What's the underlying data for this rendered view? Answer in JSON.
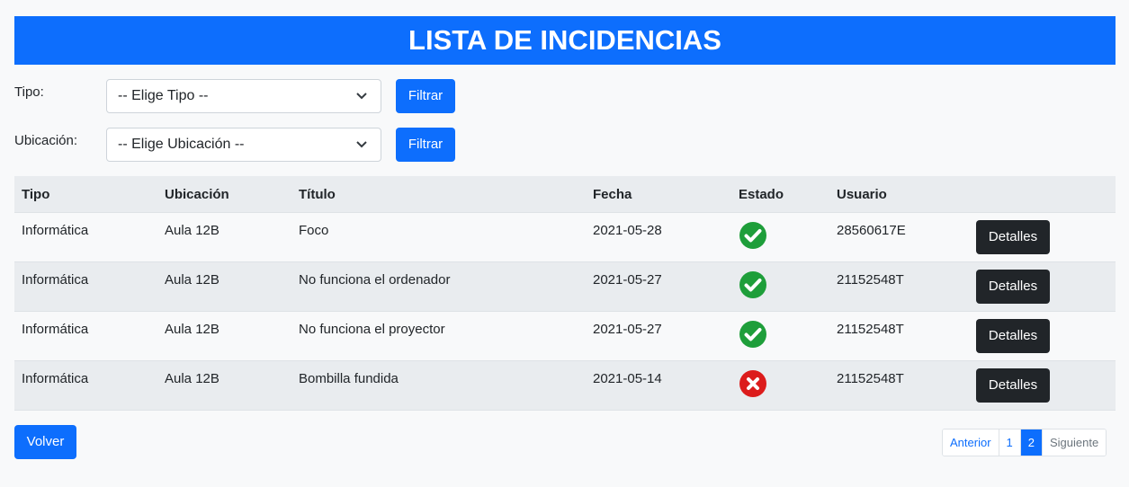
{
  "header": {
    "title": "LISTA DE INCIDENCIAS"
  },
  "filters": {
    "tipo_label": "Tipo:",
    "tipo_value": "-- Elige Tipo --",
    "ubicacion_label": "Ubicación:",
    "ubicacion_value": "-- Elige Ubicación --",
    "filter_button": "Filtrar"
  },
  "table": {
    "headers": [
      "Tipo",
      "Ubicación",
      "Título",
      "Fecha",
      "Estado",
      "Usuario"
    ],
    "rows": [
      {
        "tipo": "Informática",
        "ubicacion": "Aula 12B",
        "titulo": "Foco",
        "fecha": "2021-05-28",
        "estado": "check-icon",
        "usuario": "28560617E"
      },
      {
        "tipo": "Informática",
        "ubicacion": "Aula 12B",
        "titulo": "No funciona el ordenador",
        "fecha": "2021-05-27",
        "estado": "check-icon",
        "usuario": "21152548T"
      },
      {
        "tipo": "Informática",
        "ubicacion": "Aula 12B",
        "titulo": "No funciona el proyector",
        "fecha": "2021-05-27",
        "estado": "check-icon",
        "usuario": "21152548T"
      },
      {
        "tipo": "Informática",
        "ubicacion": "Aula 12B",
        "titulo": "Bombilla fundida",
        "fecha": "2021-05-14",
        "estado": "cross-icon",
        "usuario": "21152548T"
      }
    ],
    "details_button": "Detalles"
  },
  "footer": {
    "back_button": "Volver",
    "pagination": {
      "prev": "Anterior",
      "pages": [
        "1",
        "2"
      ],
      "active_page": "2",
      "next": "Siguiente"
    }
  },
  "colors": {
    "primary": "#0d6efd",
    "dark": "#212529",
    "success": "#1e9e3a",
    "danger": "#dc1c1c"
  }
}
